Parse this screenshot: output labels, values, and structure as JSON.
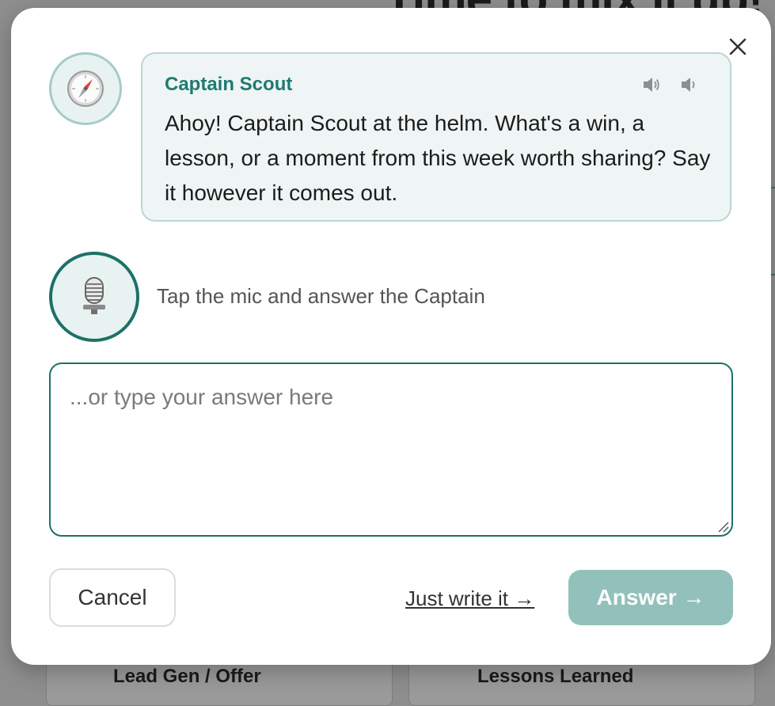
{
  "background": {
    "heading": "Time to mix it up!",
    "cards": [
      "Lead Gen / Offer",
      "Lessons Learned"
    ]
  },
  "modal": {
    "close_icon": "close-icon",
    "captain": {
      "avatar_icon": "compass-icon",
      "name": "Captain Scout",
      "message": "Ahoy! Captain Scout at the helm. What's a win, a lesson, or a moment from this week worth sharing? Say it however it comes out.",
      "speaker_icons": [
        "speaker-icon",
        "speaker-icon"
      ]
    },
    "mic": {
      "icon": "microphone-icon",
      "hint": "Tap the mic and answer the Captain"
    },
    "answer_input": {
      "value": "",
      "placeholder": "...or type your answer here"
    },
    "actions": {
      "cancel_label": "Cancel",
      "write_link_label": "Just write it →",
      "answer_label": "Answer →"
    }
  },
  "colors": {
    "accent": "#1d7167",
    "name_color": "#1f7a70",
    "bubble_bg": "#eff5f4",
    "answer_button_bg": "#92c0ba",
    "overlay": "#8e8e8e"
  }
}
